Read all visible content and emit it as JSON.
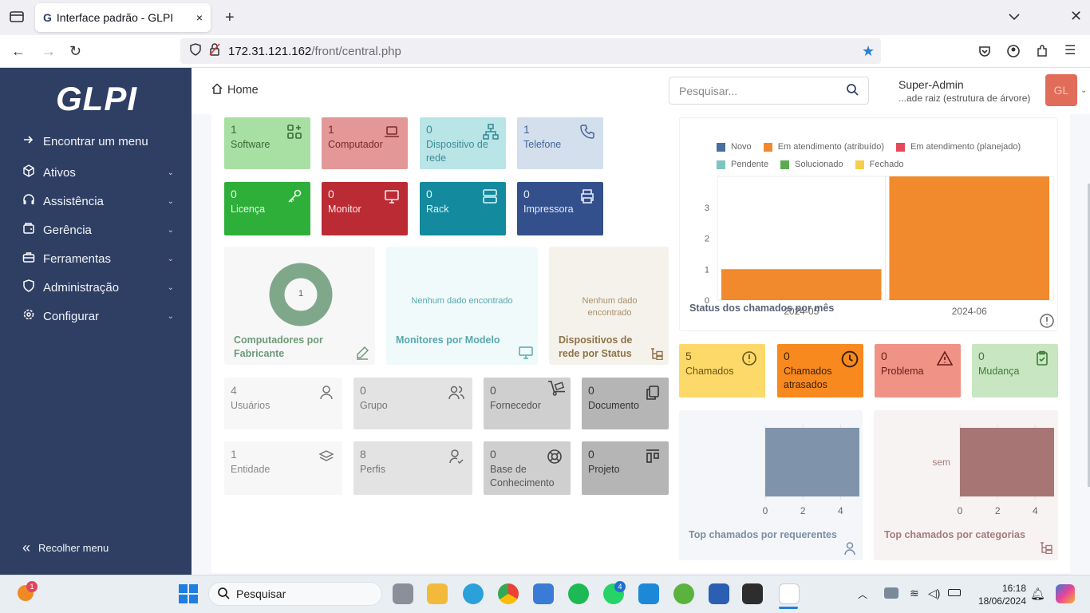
{
  "browser": {
    "tab_title": "Interface padrão - GLPI",
    "url_host": "172.31.121.162",
    "url_path": "/front/central.php"
  },
  "sidebar": {
    "logo": "GLPI",
    "items": [
      {
        "label": "Encontrar um menu",
        "icon": "arrow-right-icon"
      },
      {
        "label": "Ativos",
        "icon": "cube-icon"
      },
      {
        "label": "Assistência",
        "icon": "headset-icon"
      },
      {
        "label": "Gerência",
        "icon": "wallet-icon"
      },
      {
        "label": "Ferramentas",
        "icon": "briefcase-icon"
      },
      {
        "label": "Administração",
        "icon": "shield-icon"
      },
      {
        "label": "Configurar",
        "icon": "gear-icon"
      }
    ],
    "collapse_label": "Recolher menu"
  },
  "header": {
    "breadcrumb": "Home",
    "search_placeholder": "Pesquisar...",
    "user_name": "Super-Admin",
    "user_entity": "...ade raiz (estrutura de árvore)",
    "avatar": "GL"
  },
  "assets": [
    {
      "count": "1",
      "label": "Software",
      "color": "#a8dfa3",
      "fg": "#3c6b38"
    },
    {
      "count": "1",
      "label": "Computador",
      "color": "#e39797",
      "fg": "#7a2a2a"
    },
    {
      "count": "0",
      "label": "Dispositivo de rede",
      "color": "#b9e5e7",
      "fg": "#3a8c96"
    },
    {
      "count": "1",
      "label": "Telefone",
      "color": "#d3dfec",
      "fg": "#44669a"
    },
    {
      "count": "0",
      "label": "Licença",
      "color": "#2eaf3a",
      "fg": "#e9f9e9"
    },
    {
      "count": "0",
      "label": "Monitor",
      "color": "#bb2b34",
      "fg": "#fde8e8"
    },
    {
      "count": "0",
      "label": "Rack",
      "color": "#138a9e",
      "fg": "#dff5f8"
    },
    {
      "count": "0",
      "label": "Impressora",
      "color": "#33508c",
      "fg": "#e4ebf8"
    }
  ],
  "cards": {
    "computers_by_maker": {
      "title": "Computadores por Fabricante",
      "donut_value": "1"
    },
    "monitors_by_model": {
      "title": "Monitores por Modelo",
      "empty": "Nenhum dado encontrado"
    },
    "network_by_status": {
      "title": "Dispositivos de rede por Status",
      "empty": "Nenhum dado encontrado"
    }
  },
  "admin": [
    {
      "count": "4",
      "label": "Usuários",
      "color": "#f7f7f7"
    },
    {
      "count": "0",
      "label": "Grupo",
      "color": "#e3e3e3"
    },
    {
      "count": "0",
      "label": "Fornecedor",
      "color": "#cfcfcf"
    },
    {
      "count": "0",
      "label": "Documento",
      "color": "#b5b5b5"
    },
    {
      "count": "1",
      "label": "Entidade",
      "color": "#f7f7f7"
    },
    {
      "count": "8",
      "label": "Perfis",
      "color": "#e3e3e3"
    },
    {
      "count": "0",
      "label": "Base de Conhecimento",
      "color": "#cfcfcf"
    },
    {
      "count": "0",
      "label": "Projeto",
      "color": "#b5b5b5"
    }
  ],
  "tickets_chart": {
    "title": "Status dos chamados por mês",
    "legend": [
      {
        "label": "Novo",
        "color": "#49709d"
      },
      {
        "label": "Em atendimento (atribuído)",
        "color": "#f1892d"
      },
      {
        "label": "Em atendimento (planejado)",
        "color": "#e4495a"
      },
      {
        "label": "Pendente",
        "color": "#7fc4c0"
      },
      {
        "label": "Solucionado",
        "color": "#5aab4f"
      },
      {
        "label": "Fechado",
        "color": "#f3cf4c"
      }
    ],
    "y_ticks": [
      "0",
      "1",
      "2",
      "3"
    ],
    "categories": [
      "2024-05",
      "2024-06"
    ]
  },
  "chart_data": [
    {
      "type": "bar",
      "title": "Status dos chamados por mês",
      "categories": [
        "2024-05",
        "2024-06"
      ],
      "series": [
        {
          "name": "Em atendimento (atribuído)",
          "values": [
            1,
            4
          ]
        }
      ],
      "ylim": [
        0,
        4
      ],
      "legend": "top"
    },
    {
      "type": "bar",
      "title": "Top chamados por requerentes",
      "categories": [
        ""
      ],
      "values": [
        5
      ],
      "xlim": [
        0,
        5
      ],
      "orientation": "horizontal"
    },
    {
      "type": "bar",
      "title": "Top chamados por categorias",
      "categories": [
        "sem"
      ],
      "values": [
        5
      ],
      "xlim": [
        0,
        5
      ],
      "orientation": "horizontal"
    }
  ],
  "ticket_tiles": [
    {
      "count": "5",
      "label": "Chamados",
      "color": "#fdd96a",
      "fg": "#6a5410"
    },
    {
      "count": "0",
      "label": "Chamados atrasados",
      "color": "#f7891f",
      "fg": "#3d2206"
    },
    {
      "count": "0",
      "label": "Problema",
      "color": "#f09285",
      "fg": "#6a1e16"
    },
    {
      "count": "0",
      "label": "Mudança",
      "color": "#c8e6c2",
      "fg": "#3e7a36"
    }
  ],
  "hbar_ticks": [
    "0",
    "2",
    "4"
  ],
  "requesters_title": "Top chamados por requerentes",
  "categories_title": "Top chamados por categorias",
  "category_label": "sem",
  "taskbar": {
    "search": "Pesquisar",
    "time": "16:18",
    "date": "18/06/2024",
    "notif_badge": "1",
    "whatsapp_badge": "4"
  }
}
